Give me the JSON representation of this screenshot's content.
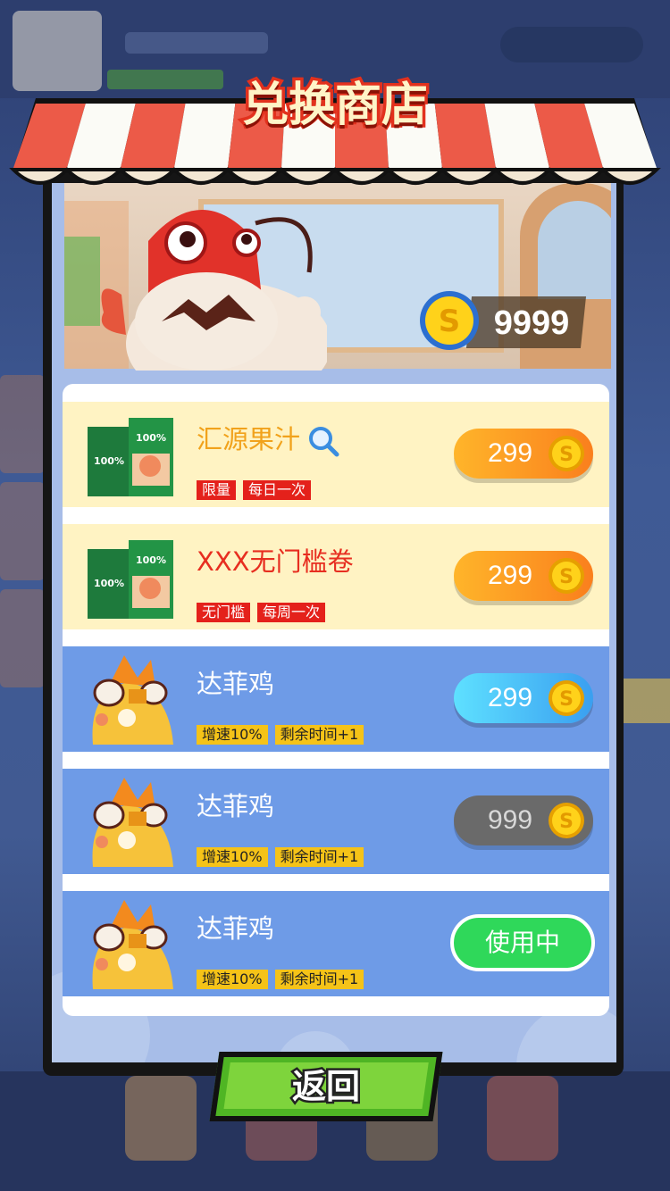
{
  "title": "兑换商店",
  "balance": "9999",
  "items": [
    {
      "name": "汇源果汁",
      "tags": [
        "限量",
        "每日一次"
      ],
      "price": "299",
      "button_style": "orange",
      "has_search": true
    },
    {
      "name": "XXX无门槛卷",
      "tags": [
        "无门槛",
        "每周一次"
      ],
      "price": "299",
      "button_style": "orange",
      "has_search": false
    },
    {
      "name": "达菲鸡",
      "tags": [
        "增速10%",
        "剩余时间+1"
      ],
      "price": "299",
      "button_style": "cyan",
      "has_search": false
    },
    {
      "name": "达菲鸡",
      "tags": [
        "增速10%",
        "剩余时间+1"
      ],
      "price": "999",
      "button_style": "gray",
      "has_search": false
    },
    {
      "name": "达菲鸡",
      "tags": [
        "增速10%",
        "剩余时间+1"
      ],
      "status": "使用中",
      "button_style": "green",
      "has_search": false
    }
  ],
  "return_label": "返回",
  "colors": {
    "accent_orange": "#fa9a22",
    "accent_red": "#e4211b",
    "accent_green": "#2fd85a",
    "row_yellow": "#fff3c3",
    "row_blue": "#6e9be7"
  }
}
